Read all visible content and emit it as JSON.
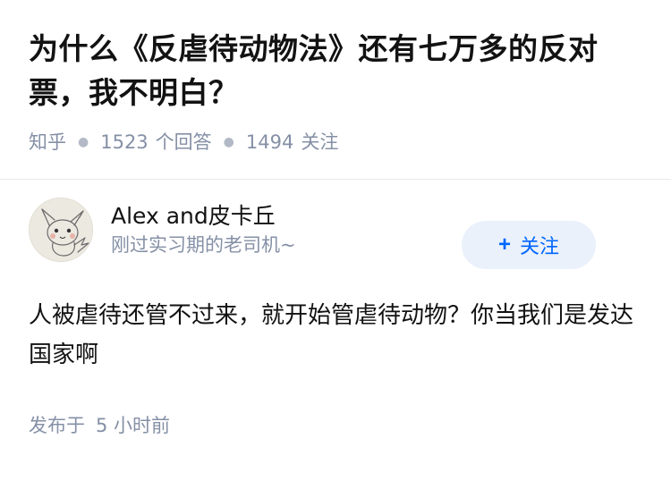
{
  "question": {
    "title": "为什么《反虐待动物法》还有七万多的反对票，我不明白？",
    "source": "知乎",
    "answer_count": "1523",
    "answer_label": "个回答",
    "follower_count": "1494",
    "follower_label": "关注"
  },
  "answer": {
    "author": {
      "name": "Alex and皮卡丘",
      "bio": "刚过实习期的老司机~",
      "avatar_icon": "pikachu-sketch-avatar"
    },
    "follow_button": {
      "icon": "+",
      "label": "关注",
      "color": "#0066ff",
      "background": "#eaf1fb"
    },
    "content": "人被虐待还管不过来，就开始管虐待动物？你当我们是发达国家啊",
    "published_prefix": "发布于",
    "published_time": "5 小时前"
  },
  "colors": {
    "title": "#121212",
    "meta": "#8590a6",
    "divider": "#ebebeb"
  }
}
